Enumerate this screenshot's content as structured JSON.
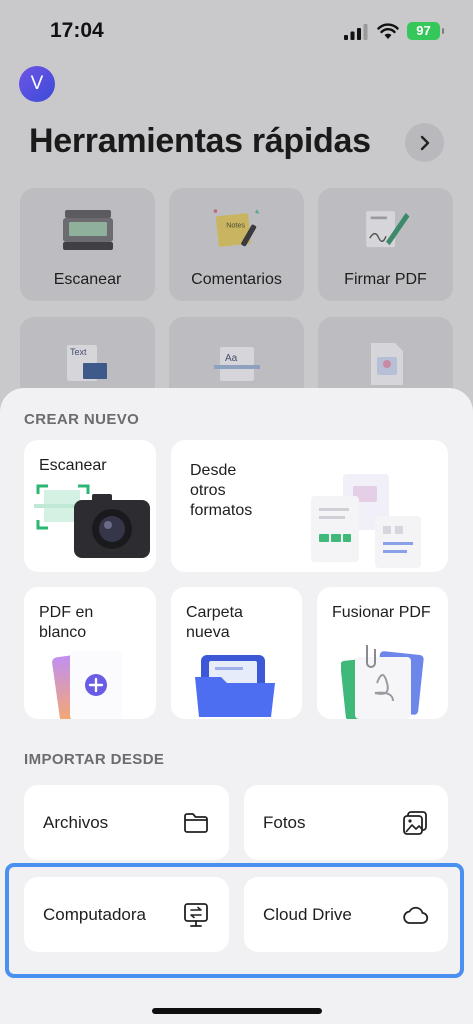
{
  "status": {
    "time": "17:04",
    "battery": "97"
  },
  "header": {
    "avatar_letter": "V",
    "title": "Herramientas rápidas"
  },
  "tools": [
    {
      "label": "Escanear"
    },
    {
      "label": "Comentarios"
    },
    {
      "label": "Firmar PDF"
    }
  ],
  "tool_icons": {
    "notes": "Notes",
    "text": "Text",
    "aa": "Aa"
  },
  "create": {
    "title": "CREAR NUEVO",
    "scan": "Escanear",
    "formats": "Desde\notros\nformatos",
    "blank": "PDF en\nblanco",
    "folder": "Carpeta\nnueva",
    "merge": "Fusionar PDF"
  },
  "import": {
    "title": "IMPORTAR DESDE",
    "files": "Archivos",
    "photos": "Fotos",
    "computer": "Computadora",
    "cloud": "Cloud Drive"
  },
  "colors": {
    "accent": "#4a90f0",
    "battery": "#35c759",
    "avatar": "#5a4fe0"
  }
}
